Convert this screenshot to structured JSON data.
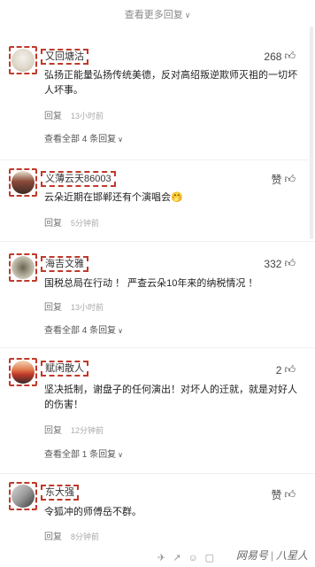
{
  "top": {
    "see_more": "查看更多回复"
  },
  "comments": [
    {
      "username": "又回塘沽",
      "likes": "268",
      "text": "弘扬正能量弘扬传统美德，反对高绍叛逆欺师灭祖的一切坏人坏事。",
      "reply_label": "回复",
      "time": "13小时前",
      "see_all": "查看全部 4 条回复"
    },
    {
      "username": "义薄云天86003",
      "likes": "赞",
      "text": "云朵近期在邯郸还有个演唱会🤭",
      "reply_label": "回复",
      "time": "5分钟前",
      "see_all": ""
    },
    {
      "username": "海吉文雅",
      "likes": "332",
      "text": "国税总局在行动 ！ 严查云朵10年来的纳税情况 ！",
      "reply_label": "回复",
      "time": "13小时前",
      "see_all": "查看全部 4 条回复"
    },
    {
      "username": "赋闲散人",
      "likes": "2",
      "text": "坚决抵制，谢盘子的任何演出！对坏人的迁就，就是对好人的伤害！",
      "reply_label": "回复",
      "time": "12分钟前",
      "see_all": "查看全部 1 条回复"
    },
    {
      "username": "东大强",
      "likes": "赞",
      "text": "令狐冲的师傅岳不群。",
      "reply_label": "回复",
      "time": "8分钟前",
      "see_all": ""
    }
  ],
  "watermark": {
    "brand": "网易号",
    "author": "八星人"
  }
}
